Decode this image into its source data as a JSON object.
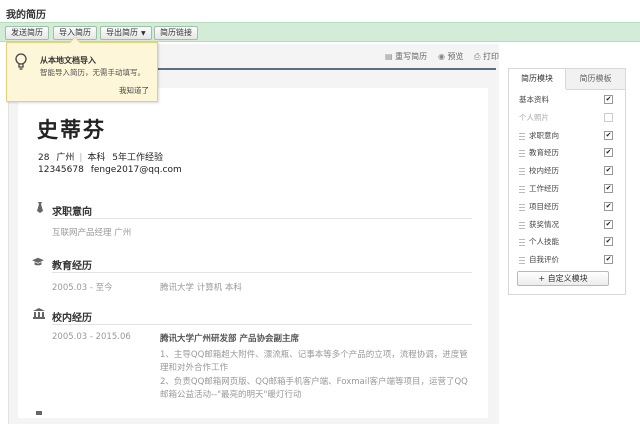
{
  "app": {
    "title": "我的简历"
  },
  "toolbar": {
    "send": "发送简历",
    "import": "导入简历",
    "export": "导出简历",
    "link": "简历链接"
  },
  "popup": {
    "title": "从本地文档导入",
    "desc": "智能导入简历，无需手动填写。",
    "dismiss": "我知道了"
  },
  "resume_actions": {
    "rewrite": "重写简历",
    "preview": "预览",
    "print": "打印"
  },
  "resume": {
    "name": "史蒂芬",
    "age": "28",
    "city": "广州",
    "degree": "本科",
    "experience": "5年工作经验",
    "phone": "12345678",
    "email": "fenge2017@qq.com",
    "sections": {
      "intent": {
        "title": "求职意向",
        "content": "互联网产品经理  广州"
      },
      "education": {
        "title": "教育经历",
        "date": "2005.03 - 至今",
        "detail": "腾讯大学  计算机  本科"
      },
      "campus": {
        "title": "校内经历",
        "date": "2005.03 - 2015.06",
        "org": "腾讯大学广州研发部   产品协会副主席",
        "lines": [
          "1、主导QQ邮箱超大附件、漂流瓶、记事本等多个产品的立项，流程协调，进度管",
          "理和对外合作工作",
          "2、负责QQ邮箱网页版、QQ邮箱手机客户端、Foxmail客户端等项目，运营了QQ",
          "邮箱公益活动--\"最亮的明天\"暖灯行动"
        ]
      }
    }
  },
  "sidebar": {
    "tabs": [
      "简历模块",
      "简历模板"
    ],
    "modules": [
      {
        "label": "基本资料",
        "checked": true,
        "enabled": true,
        "handle": false
      },
      {
        "label": "个人照片",
        "checked": false,
        "enabled": false,
        "handle": false
      },
      {
        "label": "求职意向",
        "checked": true,
        "enabled": true,
        "handle": true
      },
      {
        "label": "教育经历",
        "checked": true,
        "enabled": true,
        "handle": true
      },
      {
        "label": "校内经历",
        "checked": true,
        "enabled": true,
        "handle": true
      },
      {
        "label": "工作经历",
        "checked": true,
        "enabled": true,
        "handle": true
      },
      {
        "label": "项目经历",
        "checked": true,
        "enabled": true,
        "handle": true
      },
      {
        "label": "获奖情况",
        "checked": true,
        "enabled": true,
        "handle": true
      },
      {
        "label": "个人技能",
        "checked": true,
        "enabled": true,
        "handle": true
      },
      {
        "label": "自我评价",
        "checked": true,
        "enabled": true,
        "handle": true
      }
    ],
    "add_button": "+ 自定义模块"
  }
}
